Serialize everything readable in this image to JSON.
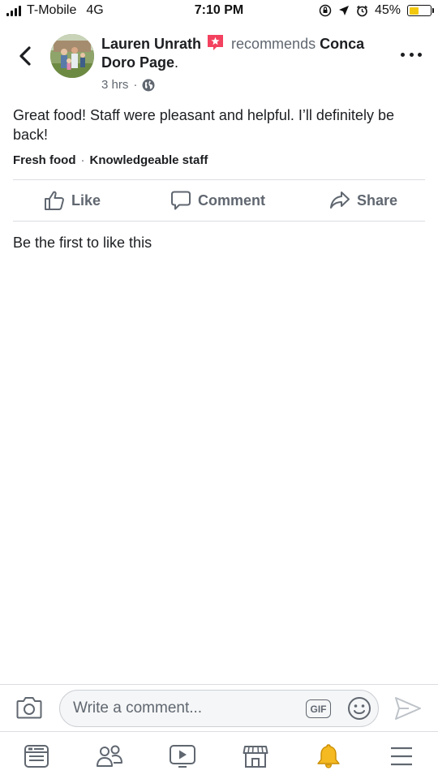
{
  "status_bar": {
    "carrier": "T-Mobile",
    "network": "4G",
    "time": "7:10 PM",
    "battery": "45%",
    "battery_level": 0.45
  },
  "post": {
    "author": "Lauren Unrath",
    "verb": "recommends",
    "target": "Conca Doro Page",
    "target_suffix": ".",
    "time_ago": "3 hrs",
    "separator": "·",
    "privacy_icon": "globe-icon",
    "text": "Great food! Staff were pleasant and helpful. I’ll definitely be back!",
    "tags": [
      "Fresh food",
      "Knowledgeable staff"
    ]
  },
  "actions": {
    "like": "Like",
    "comment": "Comment",
    "share": "Share"
  },
  "likes_summary": "Be the first to like this",
  "composer": {
    "placeholder": "Write a comment...",
    "gif_label": "GIF"
  },
  "tabs": [
    "news-feed-icon",
    "friends-icon",
    "watch-icon",
    "marketplace-icon",
    "notifications-icon",
    "menu-icon"
  ],
  "colors": {
    "text": "#1c1e21",
    "secondary": "#606770",
    "divider": "#dadde1",
    "recommend_badge": "#f3425f",
    "notification_bell": "#f5b921",
    "battery_fill": "#f2c80f"
  }
}
